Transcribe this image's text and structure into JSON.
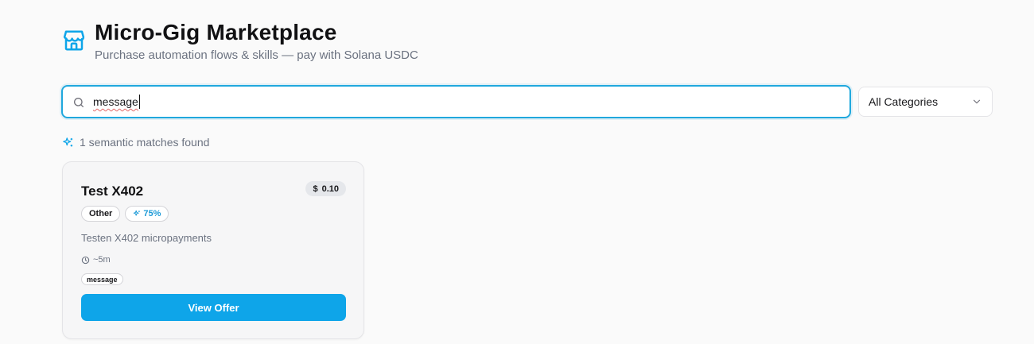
{
  "header": {
    "title": "Micro-Gig Marketplace",
    "subtitle": "Purchase automation flows & skills — pay with Solana USDC",
    "icon": "store-icon"
  },
  "search": {
    "value": "message",
    "icon": "search-icon"
  },
  "category_select": {
    "selected": "All Categories",
    "icon": "chevron-down-icon"
  },
  "results": {
    "summary": "1 semantic matches found",
    "icon": "sparkles-icon"
  },
  "offers": [
    {
      "title": "Test X402",
      "price_symbol": "$",
      "price": "0.10",
      "category": "Other",
      "match": "75%",
      "description": "Testen X402 micropayments",
      "duration": "~5m",
      "tags": [
        "message"
      ],
      "button_label": "View Offer"
    }
  ],
  "colors": {
    "accent": "#0ea5e9",
    "focus_ring": "#20a8dd",
    "muted_text": "#6b7280",
    "match_text": "#1e9bd7"
  }
}
